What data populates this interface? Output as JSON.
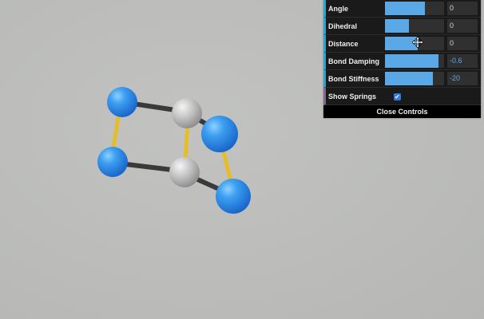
{
  "controls": {
    "rows": [
      {
        "label": "Angle",
        "value": "0",
        "level": 0.68,
        "negative": false
      },
      {
        "label": "Dihedral",
        "value": "0",
        "level": 0.4,
        "negative": false
      },
      {
        "label": "Distance",
        "value": "0",
        "level": 0.55,
        "negative": false
      },
      {
        "label": "Bond Damping",
        "value": "-0.6",
        "level": 0.91,
        "negative": true
      },
      {
        "label": "Bond Stiffness",
        "value": "-20",
        "level": 0.81,
        "negative": true
      }
    ],
    "show_springs": {
      "label": "Show Springs",
      "checked": true,
      "check_glyph": "✔"
    },
    "close_label": "Close Controls"
  },
  "colors": {
    "background": "#bcbdbb",
    "atom_blue": "#2e8fe8",
    "atom_gray": "#c8c8c8",
    "bond_dark": "#3a3a3a",
    "spring_yellow": "#e5bd2a",
    "panel_bg": "#1a1a1a",
    "slider_fill": "#5aa9e6",
    "number_accent": "#2fa1d6"
  },
  "icons": {
    "cursor": "move-cursor-icon",
    "checkbox": "check-icon"
  }
}
